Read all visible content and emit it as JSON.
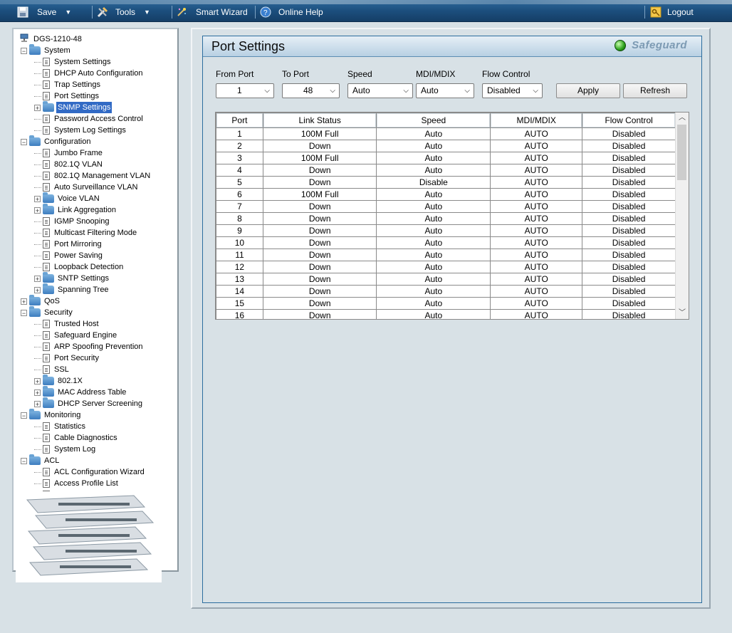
{
  "toolbar": {
    "save": "Save",
    "tools": "Tools",
    "smart_wizard": "Smart Wizard",
    "online_help": "Online Help",
    "logout": "Logout"
  },
  "tree": {
    "device": "DGS-1210-48",
    "items": [
      {
        "label": "System",
        "level": 0,
        "type": "folder",
        "expander": "−"
      },
      {
        "label": "System Settings",
        "level": 1,
        "type": "doc"
      },
      {
        "label": "DHCP Auto Configuration",
        "level": 1,
        "type": "doc"
      },
      {
        "label": "Trap Settings",
        "level": 1,
        "type": "doc"
      },
      {
        "label": "Port Settings",
        "level": 1,
        "type": "doc"
      },
      {
        "label": "SNMP Settings",
        "level": 1,
        "type": "folder",
        "expander": "+",
        "selected": true
      },
      {
        "label": "Password Access Control",
        "level": 1,
        "type": "doc"
      },
      {
        "label": "System Log Settings",
        "level": 1,
        "type": "doc"
      },
      {
        "label": "Configuration",
        "level": 0,
        "type": "folder",
        "expander": "−"
      },
      {
        "label": "Jumbo Frame",
        "level": 1,
        "type": "doc"
      },
      {
        "label": "802.1Q VLAN",
        "level": 1,
        "type": "doc"
      },
      {
        "label": "802.1Q Management VLAN",
        "level": 1,
        "type": "doc"
      },
      {
        "label": "Auto Surveillance VLAN",
        "level": 1,
        "type": "doc"
      },
      {
        "label": "Voice VLAN",
        "level": 1,
        "type": "folder",
        "expander": "+"
      },
      {
        "label": "Link Aggregation",
        "level": 1,
        "type": "folder",
        "expander": "+"
      },
      {
        "label": "IGMP Snooping",
        "level": 1,
        "type": "doc"
      },
      {
        "label": "Multicast Filtering Mode",
        "level": 1,
        "type": "doc"
      },
      {
        "label": "Port Mirroring",
        "level": 1,
        "type": "doc"
      },
      {
        "label": "Power Saving",
        "level": 1,
        "type": "doc"
      },
      {
        "label": "Loopback Detection",
        "level": 1,
        "type": "doc"
      },
      {
        "label": "SNTP Settings",
        "level": 1,
        "type": "folder",
        "expander": "+"
      },
      {
        "label": "Spanning Tree",
        "level": 1,
        "type": "folder",
        "expander": "+"
      },
      {
        "label": "QoS",
        "level": 0,
        "type": "folder",
        "expander": "+"
      },
      {
        "label": "Security",
        "level": 0,
        "type": "folder",
        "expander": "−"
      },
      {
        "label": "Trusted Host",
        "level": 1,
        "type": "doc"
      },
      {
        "label": "Safeguard Engine",
        "level": 1,
        "type": "doc"
      },
      {
        "label": "ARP Spoofing Prevention",
        "level": 1,
        "type": "doc"
      },
      {
        "label": "Port Security",
        "level": 1,
        "type": "doc"
      },
      {
        "label": "SSL",
        "level": 1,
        "type": "doc"
      },
      {
        "label": "802.1X",
        "level": 1,
        "type": "folder",
        "expander": "+"
      },
      {
        "label": "MAC Address Table",
        "level": 1,
        "type": "folder",
        "expander": "+"
      },
      {
        "label": "DHCP Server Screening",
        "level": 1,
        "type": "folder",
        "expander": "+"
      },
      {
        "label": "Monitoring",
        "level": 0,
        "type": "folder",
        "expander": "−"
      },
      {
        "label": "Statistics",
        "level": 1,
        "type": "doc"
      },
      {
        "label": "Cable Diagnostics",
        "level": 1,
        "type": "doc"
      },
      {
        "label": "System Log",
        "level": 1,
        "type": "doc"
      },
      {
        "label": "ACL",
        "level": 0,
        "type": "folder",
        "expander": "−"
      },
      {
        "label": "ACL Configuration Wizard",
        "level": 1,
        "type": "doc"
      },
      {
        "label": "Access Profile List",
        "level": 1,
        "type": "doc"
      },
      {
        "label": "ACL Finder",
        "level": 1,
        "type": "doc"
      }
    ]
  },
  "main": {
    "title": "Port Settings",
    "safeguard": "Safeguard",
    "form": {
      "from_port_label": "From Port",
      "from_port_value": "1",
      "to_port_label": "To Port",
      "to_port_value": "48",
      "speed_label": "Speed",
      "speed_value": "Auto",
      "mdi_label": "MDI/MDIX",
      "mdi_value": "Auto",
      "flow_label": "Flow Control",
      "flow_value": "Disabled",
      "apply": "Apply",
      "refresh": "Refresh"
    },
    "table": {
      "headers": [
        "Port",
        "Link Status",
        "Speed",
        "MDI/MDIX",
        "Flow Control"
      ],
      "rows": [
        [
          "1",
          "100M Full",
          "Auto",
          "AUTO",
          "Disabled"
        ],
        [
          "2",
          "Down",
          "Auto",
          "AUTO",
          "Disabled"
        ],
        [
          "3",
          "100M Full",
          "Auto",
          "AUTO",
          "Disabled"
        ],
        [
          "4",
          "Down",
          "Auto",
          "AUTO",
          "Disabled"
        ],
        [
          "5",
          "Down",
          "Disable",
          "AUTO",
          "Disabled"
        ],
        [
          "6",
          "100M Full",
          "Auto",
          "AUTO",
          "Disabled"
        ],
        [
          "7",
          "Down",
          "Auto",
          "AUTO",
          "Disabled"
        ],
        [
          "8",
          "Down",
          "Auto",
          "AUTO",
          "Disabled"
        ],
        [
          "9",
          "Down",
          "Auto",
          "AUTO",
          "Disabled"
        ],
        [
          "10",
          "Down",
          "Auto",
          "AUTO",
          "Disabled"
        ],
        [
          "11",
          "Down",
          "Auto",
          "AUTO",
          "Disabled"
        ],
        [
          "12",
          "Down",
          "Auto",
          "AUTO",
          "Disabled"
        ],
        [
          "13",
          "Down",
          "Auto",
          "AUTO",
          "Disabled"
        ],
        [
          "14",
          "Down",
          "Auto",
          "AUTO",
          "Disabled"
        ],
        [
          "15",
          "Down",
          "Auto",
          "AUTO",
          "Disabled"
        ],
        [
          "16",
          "Down",
          "Auto",
          "AUTO",
          "Disabled"
        ]
      ]
    }
  }
}
